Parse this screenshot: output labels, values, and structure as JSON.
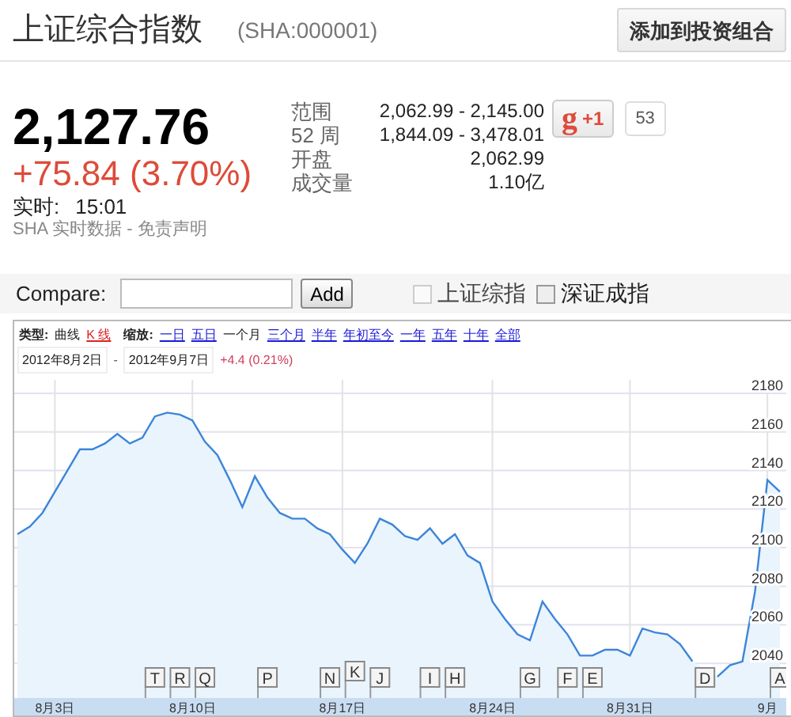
{
  "header": {
    "title": "上证综合指数",
    "symbol": "(SHA:000001)",
    "portfolio_button": "添加到投资组合"
  },
  "quote": {
    "price": "2,127.76",
    "change": "+75.84 (3.70%)",
    "time_label": "实时:",
    "time": "15:01",
    "source": "SHA 实时数据 - 免责声明"
  },
  "stats": [
    {
      "label": "范围",
      "value": "2,062.99 - 2,145.00"
    },
    {
      "label": "52 周",
      "value": "1,844.09 - 3,478.01"
    },
    {
      "label": "开盘",
      "value": "2,062.99"
    },
    {
      "label": "成交量",
      "value": "1.10亿"
    }
  ],
  "plus_one": {
    "logo": "g",
    "label": "+1",
    "count": "53"
  },
  "compare": {
    "label": "Compare:",
    "button": "Add",
    "indices": [
      {
        "label": "上证综指",
        "checked": false,
        "disabled": true
      },
      {
        "label": "深证成指",
        "checked": false,
        "disabled": false
      }
    ]
  },
  "chart_toolbar": {
    "type_label": "类型:",
    "types": [
      {
        "label": "曲线",
        "selected": true
      },
      {
        "label": "K 线",
        "selected": false
      }
    ],
    "zoom_label": "缩放:",
    "zooms": [
      {
        "label": "一日",
        "selected": false
      },
      {
        "label": "五日",
        "selected": false
      },
      {
        "label": "一个月",
        "selected": true
      },
      {
        "label": "三个月",
        "selected": false
      },
      {
        "label": "半年",
        "selected": false
      },
      {
        "label": "年初至今",
        "selected": false
      },
      {
        "label": "一年",
        "selected": false
      },
      {
        "label": "五年",
        "selected": false
      },
      {
        "label": "十年",
        "selected": false
      },
      {
        "label": "全部",
        "selected": false
      }
    ]
  },
  "range": {
    "start": "2012年8月2日",
    "separator": "-",
    "end": "2012年9月7日",
    "change": "+4.4 (0.21%)"
  },
  "chart_data": {
    "type": "area",
    "grid": true,
    "categories": [
      null,
      null,
      null,
      "8月3日",
      null,
      null,
      null,
      null,
      null,
      null,
      null,
      null,
      null,
      null,
      "8月10日",
      null,
      null,
      null,
      null,
      null,
      null,
      null,
      null,
      null,
      null,
      null,
      "8月17日",
      null,
      null,
      null,
      null,
      null,
      null,
      null,
      null,
      null,
      null,
      null,
      "8月24日",
      null,
      null,
      null,
      null,
      null,
      null,
      null,
      null,
      null,
      null,
      "8月31日",
      null,
      null,
      null,
      null,
      null,
      null,
      null,
      null,
      null,
      null,
      "9月",
      null
    ],
    "ylim": [
      2022,
      2187
    ],
    "yticks": [
      2040,
      2060,
      2080,
      2100,
      2120,
      2140,
      2160,
      2180
    ],
    "series": [
      {
        "color": "#3d85d8",
        "values": [
          2107,
          2111,
          2118,
          2129,
          2140,
          2151,
          2151,
          2154,
          2159,
          2154,
          2157,
          2168,
          2170,
          2169,
          2166,
          2155,
          2148,
          2135,
          2121,
          2137,
          2126,
          2118,
          2115,
          2115,
          2110,
          2107,
          2099,
          2092,
          2102,
          2115,
          2112,
          2106,
          2104,
          2110,
          2102,
          2107,
          2096,
          2092,
          2072,
          2063,
          2055,
          2052,
          2072,
          2063,
          2055,
          2044,
          2044,
          2047,
          2047,
          2044,
          2058,
          2056,
          2055,
          2050,
          2041,
          null,
          2033,
          2039,
          2041,
          2077,
          2135,
          2129
        ]
      }
    ],
    "annotations": [
      "T",
      "R",
      "Q",
      "P",
      "N",
      "K",
      "J",
      "I",
      "H",
      "G",
      "F",
      "E",
      "D",
      "A"
    ]
  }
}
